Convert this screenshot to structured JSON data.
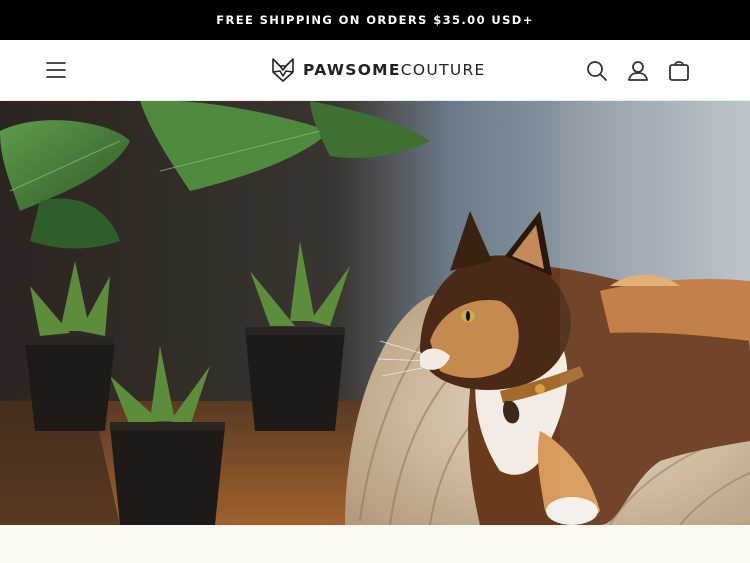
{
  "announcement": {
    "text": "FREE SHIPPING ON ORDERS $35.00 USD+"
  },
  "header": {
    "brand_bold": "PAWSOME",
    "brand_light": "COUTURE",
    "icons": [
      "menu-icon",
      "search-icon",
      "account-icon",
      "cart-icon"
    ]
  },
  "colors": {
    "announcement_bg": "#000000",
    "header_bg": "#ffffff",
    "page_bg": "#fdf8f1",
    "text": "#222222"
  }
}
